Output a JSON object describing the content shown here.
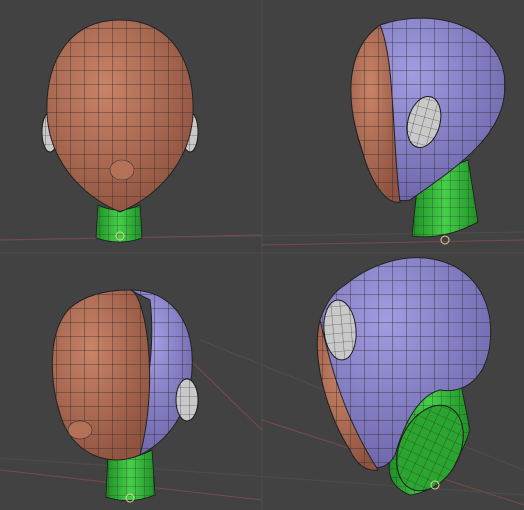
{
  "viewport": {
    "background": "#424242",
    "grid_color": "#4f4f4f",
    "axis_x_color": "#8a4b4b",
    "axis_y_color": "#5f7d5f"
  },
  "materials": {
    "face": "#b87358",
    "face_shade": "#8f5340",
    "back": "#8d86c9",
    "back_shade": "#6b64a8",
    "neck": "#35c03a",
    "neck_shade": "#1f8f25",
    "ear": "#c9c9c9",
    "wire": "#2a2a2a"
  },
  "views": [
    {
      "name": "front-view"
    },
    {
      "name": "three-quarter-back-view"
    },
    {
      "name": "three-quarter-front-view"
    },
    {
      "name": "side-back-perspective-view"
    }
  ]
}
